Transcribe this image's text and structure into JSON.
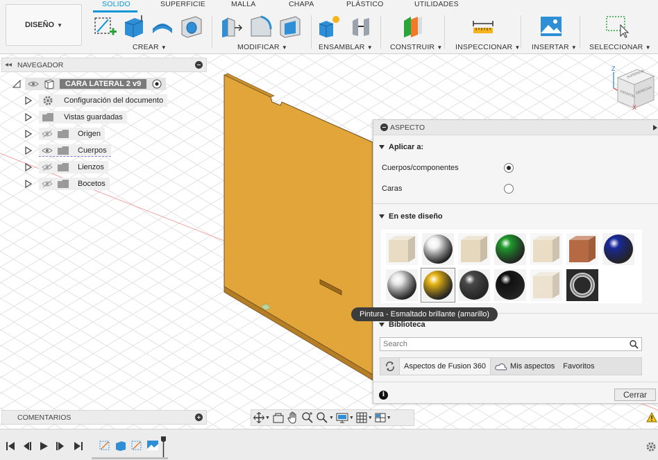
{
  "workspace": {
    "label": "DISEÑO"
  },
  "tabs": [
    "SOLIDO",
    "SUPERFICIE",
    "MALLA",
    "CHAPA",
    "PLÁSTICO",
    "UTILIDADES"
  ],
  "active_tab": "SOLIDO",
  "groups": [
    "CREAR",
    "MODIFICAR",
    "ENSAMBLAR",
    "CONSTRUIR",
    "INSPECCIONAR",
    "INSERTAR",
    "SELECCIONAR"
  ],
  "browser": {
    "title": "NAVEGADOR",
    "root": "CARA LATERAL 2 v9",
    "items": [
      {
        "label": "Configuración del documento",
        "icon": "gear-icon"
      },
      {
        "label": "Vistas guardadas",
        "icon": "folder-icon"
      },
      {
        "label": "Origen",
        "icon": "folder-icon",
        "visible": false
      },
      {
        "label": "Cuerpos",
        "icon": "folder-icon",
        "visible": true
      },
      {
        "label": "Lienzos",
        "icon": "folder-icon",
        "visible": false
      },
      {
        "label": "Bocetos",
        "icon": "folder-icon",
        "visible": false
      }
    ]
  },
  "comments": {
    "title": "COMENTARIOS"
  },
  "viewcube": {
    "front": "FRONTAL",
    "right": "DERECHA",
    "top": "SUPERIOR",
    "axis_z": "Z",
    "axis_x": "X"
  },
  "appearance": {
    "title": "ASPECTO",
    "apply_title": "Aplicar a:",
    "options": [
      {
        "label": "Cuerpos/componentes",
        "selected": true
      },
      {
        "label": "Caras",
        "selected": false
      }
    ],
    "in_design_title": "En este diseño",
    "swatches": [
      {
        "type": "cube",
        "color": "#e8dcc4"
      },
      {
        "type": "sphere",
        "color": "#f2f2f2"
      },
      {
        "type": "cube",
        "color": "#e6d8bd"
      },
      {
        "type": "sphere",
        "color": "#1f9a2c"
      },
      {
        "type": "cube",
        "color": "#e9ddc6"
      },
      {
        "type": "cube",
        "color": "#b56a43"
      },
      {
        "type": "sphere",
        "color": "#1a2a9a"
      },
      {
        "type": "sphere",
        "color": "#e8e8e8"
      },
      {
        "type": "sphere",
        "color": "#e7b516",
        "selected": true
      },
      {
        "type": "sphere",
        "color": "#4a4a4a"
      },
      {
        "type": "sphere",
        "color": "#111111"
      },
      {
        "type": "cube",
        "color": "#ece2cf"
      },
      {
        "type": "ring",
        "color": "#777777"
      }
    ],
    "tooltip": "Pintura - Esmaltado brillante (amarillo)",
    "library_title": "Biblioteca",
    "search_placeholder": "Search",
    "library_tabs": [
      "Aspectos de Fusion 360",
      "Mis aspectos",
      "Favoritos"
    ],
    "close_label": "Cerrar"
  },
  "model_color": "#e2a53a",
  "accent_color": "#0696d7"
}
